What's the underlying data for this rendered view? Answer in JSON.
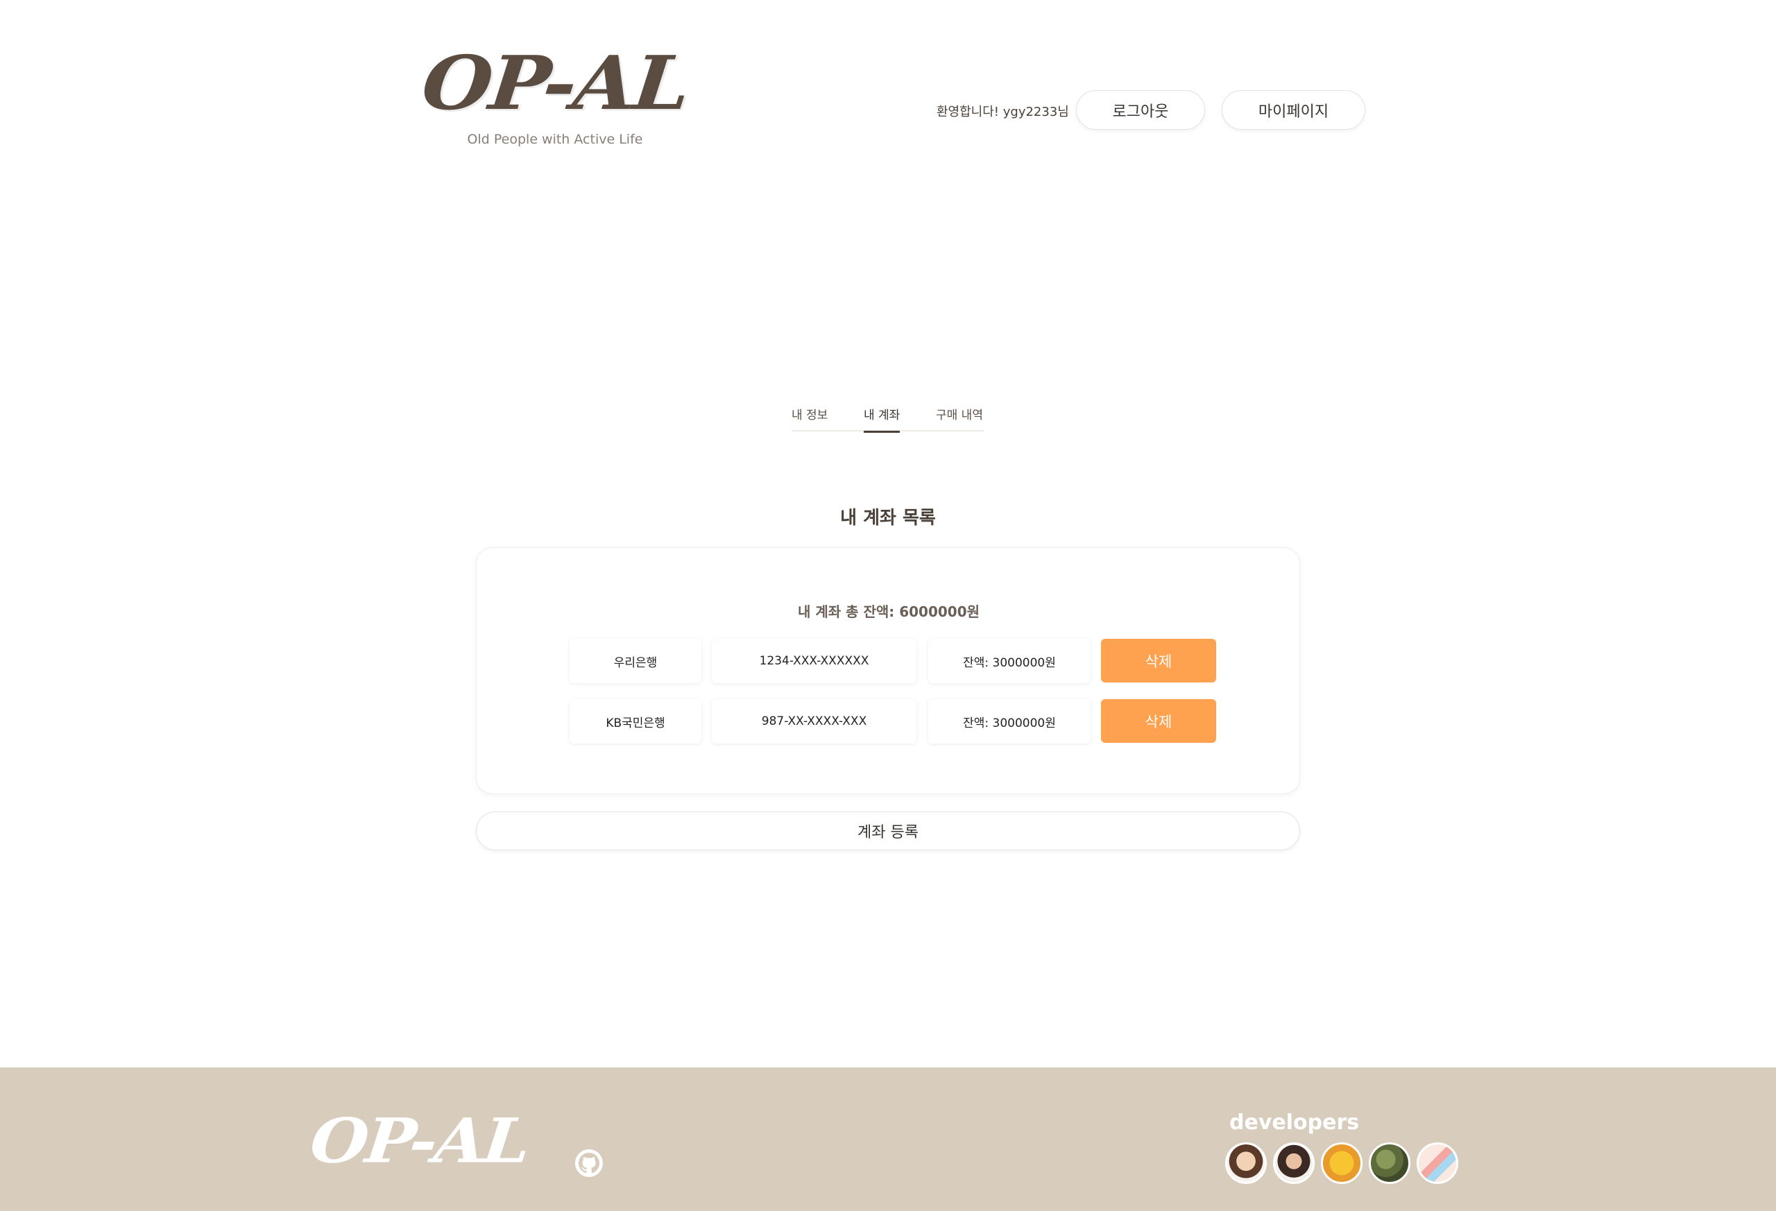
{
  "header": {
    "logo": "OP-AL",
    "tagline": "Old People with Active Life",
    "welcome": "환영합니다! ygy2233님",
    "logout_label": "로그아웃",
    "mypage_label": "마이페이지"
  },
  "tabs": [
    {
      "label": "내 정보"
    },
    {
      "label": "내 계좌",
      "active": true
    },
    {
      "label": "구매 내역"
    }
  ],
  "accounts": {
    "title": "내 계좌 목록",
    "total": "내 계좌 총 잔액: 6000000원",
    "rows": [
      {
        "bank": "우리은행",
        "number": "1234-XXX-XXXXXX",
        "balance": "잔액: 3000000원",
        "delete_label": "삭제"
      },
      {
        "bank": "KB국민은행",
        "number": "987-XX-XXXX-XXX",
        "balance": "잔액: 3000000원",
        "delete_label": "삭제"
      }
    ],
    "register_label": "계좌 등록"
  },
  "footer": {
    "logo": "OP-AL",
    "github_icon": "github-icon",
    "developers_title": "developers",
    "developers": [
      "developer-avatar-1",
      "developer-avatar-2",
      "developer-avatar-3",
      "developer-avatar-4",
      "developer-avatar-5"
    ]
  },
  "colors": {
    "brand_brown": "#5a4c40",
    "accent_orange": "#ffa24f",
    "footer_bg": "#d8ccbd"
  }
}
